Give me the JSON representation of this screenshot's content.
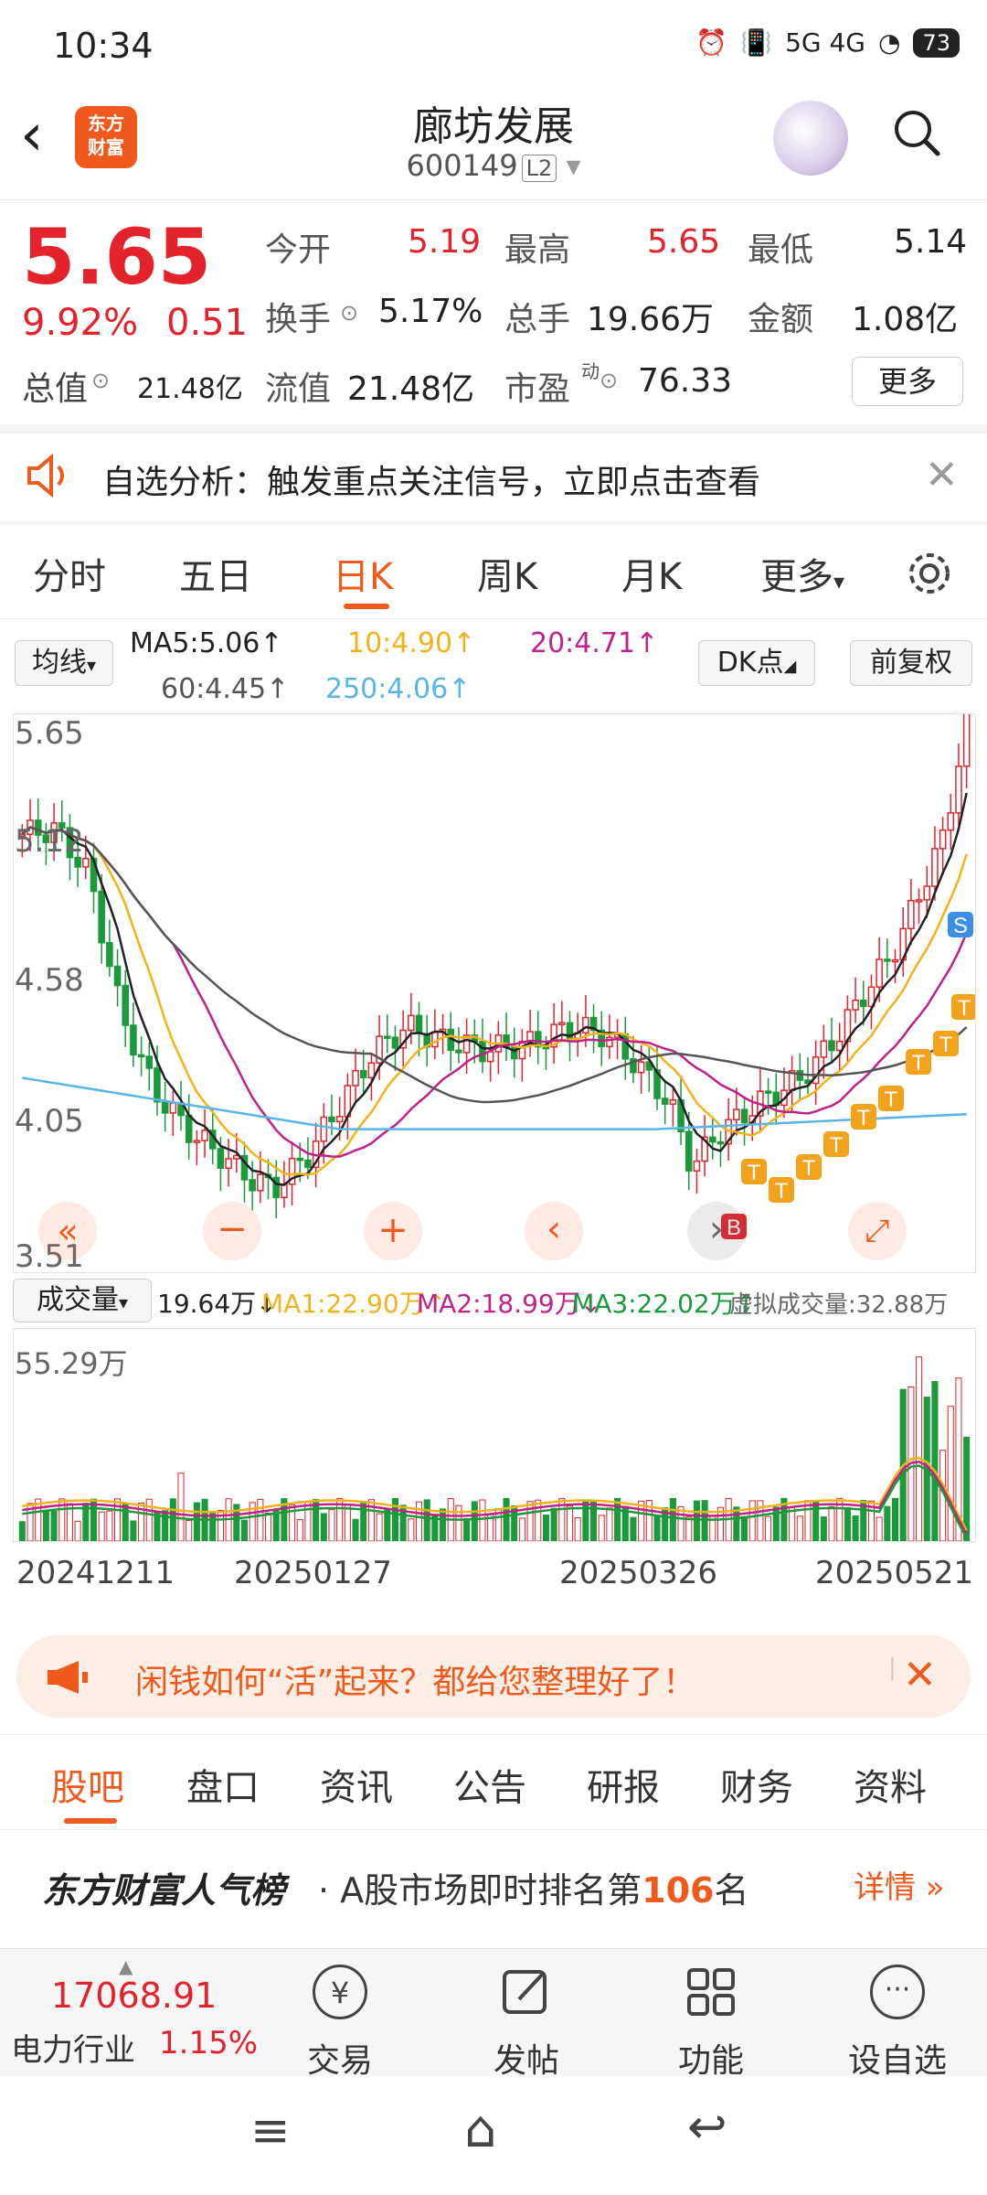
{
  "status": {
    "time": "10:34",
    "network": "5G 4G",
    "battery": "73"
  },
  "header": {
    "title": "廊坊发展",
    "code": "600149",
    "level": "L2",
    "logo": "东方\n财富"
  },
  "quote": {
    "price": "5.65",
    "pct": "9.92%",
    "change": "0.51",
    "open_label": "今开",
    "open": "5.19",
    "high_label": "最高",
    "high": "5.65",
    "low_label": "最低",
    "low": "5.14",
    "turnover_label": "换手",
    "turnover": "5.17%",
    "volume_label": "总手",
    "volume": "19.66万",
    "amount_label": "金额",
    "amount": "1.08亿",
    "mcap_label": "总值",
    "mcap": "21.48亿",
    "float_label": "流值",
    "float_cap": "21.48亿",
    "pe_label": "市盈",
    "pe_sup": "动",
    "pe": "76.33",
    "more": "更多"
  },
  "alert": {
    "text": "自选分析：触发重点关注信号，立即点击查看"
  },
  "tabs": [
    "分时",
    "五日",
    "日K",
    "周K",
    "月K",
    "更多"
  ],
  "ma": {
    "selector": "均线",
    "ma5": "MA5:5.06↑",
    "ma10": "10:4.90↑",
    "ma20": "20:4.71↑",
    "ma60": "60:4.45↑",
    "ma250": "250:4.06↑",
    "dk": "DK点",
    "adjust": "前复权"
  },
  "chart_labels": {
    "top": "5.65",
    "l2": "5.12",
    "l3": "4.58",
    "l4": "4.05",
    "bottom": "3.51",
    "buy": "B",
    "sell": "S",
    "t": "T"
  },
  "volume": {
    "selector": "成交量",
    "current": "19.64万↓",
    "ma1": "MA1:22.90万↑",
    "ma2": "MA2:18.99万↓",
    "ma3": "MA3:22.02万↑",
    "virtual": "虚拟成交量:32.88万",
    "top": "55.29万"
  },
  "dates": [
    "20241211",
    "20250127",
    "20250326",
    "20250521"
  ],
  "ad": {
    "text": "闲钱如何“活”起来？都给您整理好了！"
  },
  "sub_tabs": [
    "股吧",
    "盘口",
    "资讯",
    "公告",
    "研报",
    "财务",
    "资料"
  ],
  "rank": {
    "brand": "东方财富人气榜",
    "text_pre": "· A股市场即时排名第",
    "rank": "106",
    "text_post": "名",
    "detail": "详情"
  },
  "bottom_nav": {
    "index_value": "17068.91",
    "index_name": "电力行业",
    "index_pct": "1.15%",
    "trade": "交易",
    "post": "发帖",
    "func": "功能",
    "watch": "设自选"
  },
  "colors": {
    "up": "#e3222c",
    "down": "#1a9a3a",
    "accent": "#ef5a1c",
    "ma5": "#222222",
    "ma10": "#f2b21b",
    "ma20": "#c0218a",
    "ma60": "#555555",
    "ma250": "#58b5e8"
  },
  "chart_data": {
    "type": "line",
    "y_axis_ticks": [
      5.65,
      5.12,
      4.58,
      4.05,
      3.51
    ],
    "ylim": [
      3.51,
      5.65
    ],
    "x_ticks": [
      "20241211",
      "20250127",
      "20250326",
      "20250521"
    ],
    "series": [
      {
        "name": "MA5",
        "values": [
          5.06
        ]
      },
      {
        "name": "MA10",
        "values": [
          4.9
        ]
      },
      {
        "name": "MA20",
        "values": [
          4.71
        ]
      },
      {
        "name": "MA60",
        "values": [
          4.45
        ]
      },
      {
        "name": "MA250",
        "values": [
          4.06
        ]
      }
    ]
  }
}
